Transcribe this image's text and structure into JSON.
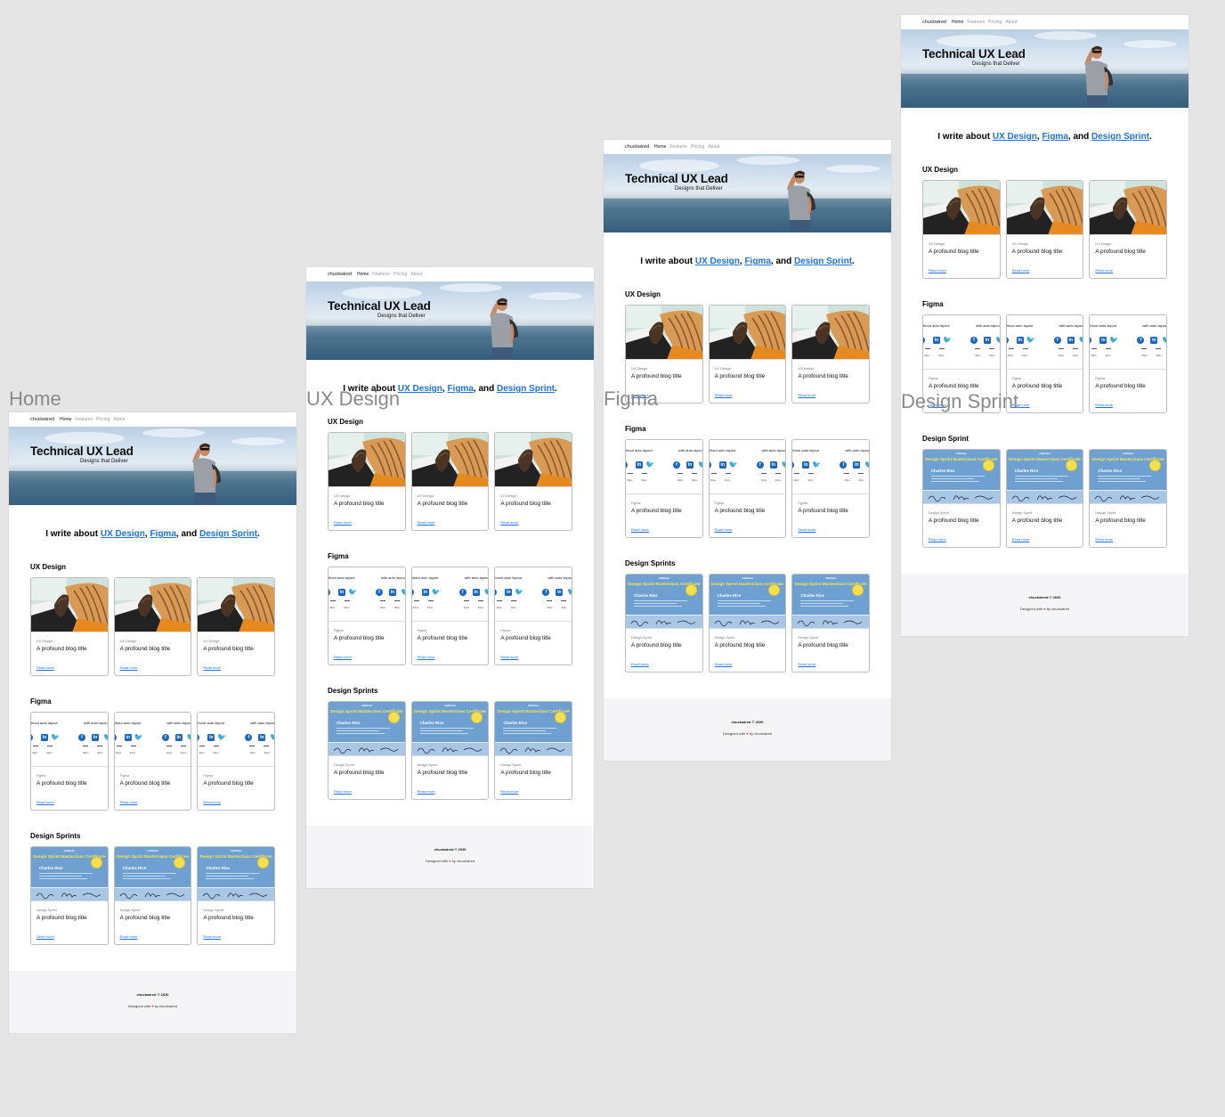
{
  "frames": [
    {
      "label": "Home",
      "sections": [
        {
          "title": "UX Design",
          "kind": "photo",
          "category": "UX Design"
        },
        {
          "title": "Figma",
          "kind": "figma",
          "category": "Figma"
        },
        {
          "title": "Design Sprints",
          "kind": "cert",
          "category": "Design Sprint"
        }
      ]
    },
    {
      "label": "UX Design",
      "sections": [
        {
          "title": "UX Design",
          "kind": "photo",
          "category": "UX Design"
        },
        {
          "title": "Figma",
          "kind": "figma",
          "category": "Figma"
        },
        {
          "title": "Design Sprints",
          "kind": "cert",
          "category": "Design Sprint"
        }
      ]
    },
    {
      "label": "Figma",
      "sections": [
        {
          "title": "UX Design",
          "kind": "photo",
          "category": "UX Design"
        },
        {
          "title": "Figma",
          "kind": "figma",
          "category": "Figma"
        },
        {
          "title": "Design Sprints",
          "kind": "cert",
          "category": "Design Sprint"
        }
      ]
    },
    {
      "label": "Design Sprint",
      "sections": [
        {
          "title": "UX Design",
          "kind": "photo",
          "category": "UX Design"
        },
        {
          "title": "Figma",
          "kind": "figma",
          "category": "Figma"
        },
        {
          "title": "Design Sprint",
          "kind": "cert",
          "category": "Design Sprint"
        }
      ]
    }
  ],
  "nav": {
    "brand": "chuckwired",
    "links": [
      "Home",
      "Features",
      "Pricing",
      "About"
    ],
    "active": "Home"
  },
  "hero": {
    "title": "Technical UX Lead",
    "subtitle": "Designs that Deliver"
  },
  "intro": {
    "prefix": "I write about ",
    "link1": "UX Design",
    "sep1": ", ",
    "link2": "Figma",
    "sep2": ", and ",
    "link3": "Design Sprint",
    "suffix": "."
  },
  "card": {
    "title": "A profound blog title",
    "link": "Read more"
  },
  "figma_thumb": {
    "label_left": "thout auto layout",
    "label_right": "with auto layou",
    "small_a": "40px",
    "small_b": "32px"
  },
  "cert_thumb": {
    "org": "AJ&Smart",
    "title": "Design Sprint Masterclass Certificate",
    "name": "Charles Rice"
  },
  "footer": {
    "copy": "chuckwired © 2020",
    "credit_prefix": "Designed with ",
    "heart": "♥",
    "credit_suffix": " by chuckwired"
  },
  "colors": {
    "canvas": "#e5e5e5",
    "link": "#1a73e8",
    "footer_bg": "#f5f5f7",
    "cert_blue": "#6fa0d2",
    "cert_yellow": "#f7e94a",
    "heart": "#e53935"
  }
}
